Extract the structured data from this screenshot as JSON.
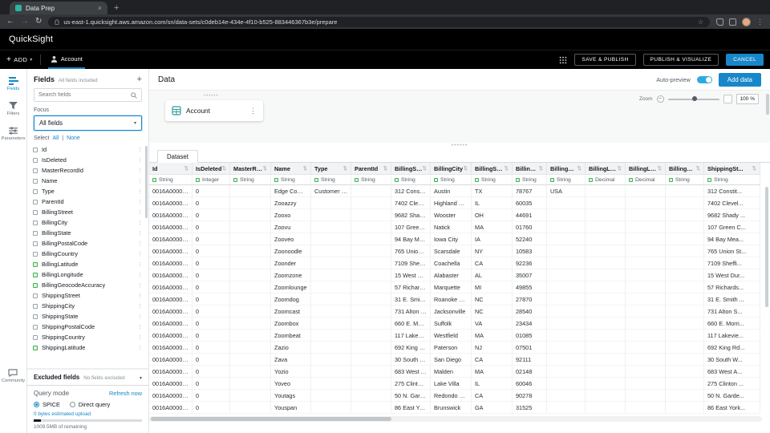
{
  "colors": {
    "accent": "#1787c9",
    "toggle_on": "#2ea9e0",
    "node_icon_teal": "#2e9e9e",
    "numeric_field_green": "#3eb34f",
    "topbar_black": "#000000"
  },
  "browser": {
    "tab_title": "Data Prep",
    "url": "us-east-1.quicksight.aws.amazon.com/sn/data-sets/c0deb14e-434e-4f10-b525-883446367b3e/prepare"
  },
  "topbar": {
    "logo": "QuickSight",
    "add_label": "ADD",
    "dataset_name": "Account",
    "actions": [
      "SAVE & PUBLISH",
      "PUBLISH & VISUALIZE",
      "CANCEL"
    ]
  },
  "rail": {
    "items": [
      {
        "label": "Fields"
      },
      {
        "label": "Filters"
      },
      {
        "label": "Parameters"
      }
    ],
    "community_label": "Community"
  },
  "fields_panel": {
    "title": "Fields",
    "subtitle": "All fields included",
    "search_placeholder": "Search fields",
    "focus_label": "Focus",
    "focus_value": "All fields",
    "select_label": "Select",
    "select_all": "All",
    "select_sep": "|",
    "select_none": "None",
    "fields": [
      {
        "name": "Id",
        "icon": "gray"
      },
      {
        "name": "IsDeleted",
        "icon": "gray"
      },
      {
        "name": "MasterRecordId",
        "icon": "gray"
      },
      {
        "name": "Name",
        "icon": "gray"
      },
      {
        "name": "Type",
        "icon": "gray"
      },
      {
        "name": "ParentId",
        "icon": "gray"
      },
      {
        "name": "BillingStreet",
        "icon": "gray"
      },
      {
        "name": "BillingCity",
        "icon": "gray"
      },
      {
        "name": "BillingState",
        "icon": "gray"
      },
      {
        "name": "BillingPostalCode",
        "icon": "gray"
      },
      {
        "name": "BillingCountry",
        "icon": "gray"
      },
      {
        "name": "BillingLatitude",
        "icon": "green"
      },
      {
        "name": "BillingLongitude",
        "icon": "green"
      },
      {
        "name": "BillingGeocodeAccuracy",
        "icon": "green"
      },
      {
        "name": "ShippingStreet",
        "icon": "gray"
      },
      {
        "name": "ShippingCity",
        "icon": "gray"
      },
      {
        "name": "ShippingState",
        "icon": "gray"
      },
      {
        "name": "ShippingPostalCode",
        "icon": "gray"
      },
      {
        "name": "ShippingCountry",
        "icon": "gray"
      },
      {
        "name": "ShippingLatitude",
        "icon": "green"
      }
    ],
    "excluded_title": "Excluded fields",
    "excluded_subtitle": "No fields excluded"
  },
  "query_mode": {
    "title": "Query mode",
    "refresh_label": "Refresh now",
    "options": [
      "SPICE",
      "Direct query"
    ],
    "selected": "SPICE",
    "upload_note": "0 bytes estimated upload",
    "remaining": "1009.5MB of remaining"
  },
  "main": {
    "title": "Data",
    "auto_preview_label": "Auto-preview",
    "add_data_label": "Add data",
    "zoom": {
      "label": "Zoom",
      "value": "100 %"
    },
    "node_label": "Account",
    "dataset_tab_label": "Dataset"
  },
  "table": {
    "columns": [
      {
        "name": "Id",
        "type": "String"
      },
      {
        "name": "IsDeleted",
        "type": "Integer"
      },
      {
        "name": "MasterRec...",
        "type": "String"
      },
      {
        "name": "Name",
        "type": "String"
      },
      {
        "name": "Type",
        "type": "String"
      },
      {
        "name": "ParentId",
        "type": "String"
      },
      {
        "name": "BillingStreet",
        "type": "String"
      },
      {
        "name": "BillingCity",
        "type": "String"
      },
      {
        "name": "BillingState",
        "type": "String"
      },
      {
        "name": "BillingPost...",
        "type": "String"
      },
      {
        "name": "BillingCou...",
        "type": "String"
      },
      {
        "name": "BillingLatit...",
        "type": "Decimal"
      },
      {
        "name": "BillingLon...",
        "type": "Decimal"
      },
      {
        "name": "BillingGeo...",
        "type": "String"
      },
      {
        "name": "ShippingSt...",
        "type": "String"
      }
    ],
    "rows": [
      [
        "0016A00000...",
        "0",
        "",
        "Edge Comm...",
        "Customer - ...",
        "",
        "312 Constit...",
        "Austin",
        "TX",
        "78767",
        "USA",
        "",
        "",
        "",
        "312 Constit..."
      ],
      [
        "0016A00000...",
        "0",
        "",
        "Zooazzy",
        "",
        "",
        "7402 Clevel...",
        "Highland Park",
        "IL",
        "60035",
        "",
        "",
        "",
        "",
        "7402 Clevel..."
      ],
      [
        "0016A00000...",
        "0",
        "",
        "Zooxo",
        "",
        "",
        "9682 Shady ...",
        "Wooster",
        "OH",
        "44691",
        "",
        "",
        "",
        "",
        "9682 Shady ..."
      ],
      [
        "0016A00000...",
        "0",
        "",
        "Zoovu",
        "",
        "",
        "107 Green C...",
        "Natick",
        "MA",
        "01760",
        "",
        "",
        "",
        "",
        "107 Green C..."
      ],
      [
        "0016A00000...",
        "0",
        "",
        "Zooveo",
        "",
        "",
        "94 Bay Mea...",
        "Iowa City",
        "IA",
        "52240",
        "",
        "",
        "",
        "",
        "94 Bay Mea..."
      ],
      [
        "0016A00000...",
        "0",
        "",
        "Zoonoodle",
        "",
        "",
        "765 Union St.",
        "Scarsdale",
        "NY",
        "10583",
        "",
        "",
        "",
        "",
        "765 Union St..."
      ],
      [
        "0016A00000...",
        "0",
        "",
        "Zoonder",
        "",
        "",
        "7109 Sheffi...",
        "Coachella",
        "CA",
        "92236",
        "",
        "",
        "",
        "",
        "7109 Sheffi..."
      ],
      [
        "0016A00000...",
        "0",
        "",
        "Zoomzone",
        "",
        "",
        "15 West Dur...",
        "Alabaster",
        "AL",
        "35007",
        "",
        "",
        "",
        "",
        "15 West Dur..."
      ],
      [
        "0016A00000...",
        "0",
        "",
        "Zoomlounge",
        "",
        "",
        "57 Richards...",
        "Marquette",
        "MI",
        "49855",
        "",
        "",
        "",
        "",
        "57 Richards..."
      ],
      [
        "0016A00000...",
        "0",
        "",
        "Zoomdog",
        "",
        "",
        "31 E. Smith ...",
        "Roanoke Ra...",
        "NC",
        "27870",
        "",
        "",
        "",
        "",
        "31 E. Smith ..."
      ],
      [
        "0016A00000...",
        "0",
        "",
        "Zoomcast",
        "",
        "",
        "731 Alton St...",
        "Jacksonville",
        "NC",
        "28540",
        "",
        "",
        "",
        "",
        "731 Alton S..."
      ],
      [
        "0016A00000...",
        "0",
        "",
        "Zoombox",
        "",
        "",
        "660 E. Morri...",
        "Suffolk",
        "VA",
        "23434",
        "",
        "",
        "",
        "",
        "660 E. Morri..."
      ],
      [
        "0016A00000...",
        "0",
        "",
        "Zoombeat",
        "",
        "",
        "117 Lakevie...",
        "Westfield",
        "MA",
        "01085",
        "",
        "",
        "",
        "",
        "117 Lakevie..."
      ],
      [
        "0016A00000...",
        "0",
        "",
        "Zazio",
        "",
        "",
        "692 King Rd.",
        "Paterson",
        "NJ",
        "07501",
        "",
        "",
        "",
        "",
        "692 King Rd..."
      ],
      [
        "0016A00000...",
        "0",
        "",
        "Zava",
        "",
        "",
        "30 South W...",
        "San Diego",
        "CA",
        "92111",
        "",
        "",
        "",
        "",
        "30 South W..."
      ],
      [
        "0016A00000...",
        "0",
        "",
        "Yozio",
        "",
        "",
        "683 West An...",
        "Malden",
        "MA",
        "02148",
        "",
        "",
        "",
        "",
        "683 West A..."
      ],
      [
        "0016A00000...",
        "0",
        "",
        "Yoveo",
        "",
        "",
        "275 Clinton ...",
        "Lake Villa",
        "IL",
        "60046",
        "",
        "",
        "",
        "",
        "275 Clinton ..."
      ],
      [
        "0016A00000...",
        "0",
        "",
        "Youtags",
        "",
        "",
        "50 N. Garde...",
        "Redondo Be...",
        "CA",
        "90278",
        "",
        "",
        "",
        "",
        "50 N. Garde..."
      ],
      [
        "0016A00000...",
        "0",
        "",
        "Youspan",
        "",
        "",
        "86 East York...",
        "Brunswick",
        "GA",
        "31525",
        "",
        "",
        "",
        "",
        "86 East York..."
      ]
    ]
  }
}
